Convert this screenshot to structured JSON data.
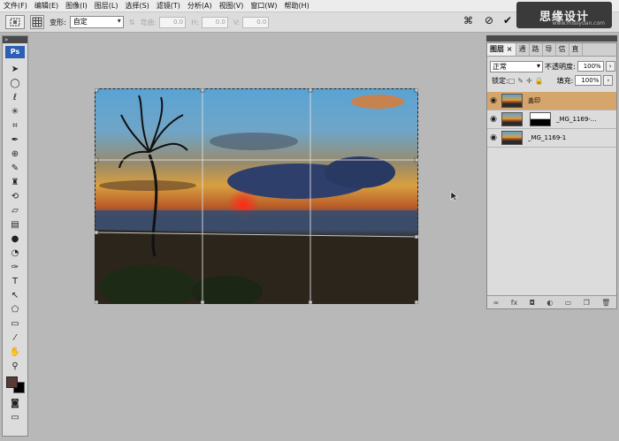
{
  "menubar": {
    "items": [
      "文件(F)",
      "编辑(E)",
      "图像(I)",
      "图层(L)",
      "选择(S)",
      "滤镜(T)",
      "分析(A)",
      "视图(V)",
      "窗口(W)",
      "帮助(H)"
    ]
  },
  "logo": {
    "main": "思缘设计",
    "sub": "www.missyuan.com"
  },
  "options_bar": {
    "transform_label": "变形:",
    "transform_value": "自定",
    "bend_label": "弯曲:",
    "bend_value": "0.0",
    "h_label": "H:",
    "h_value": "0.0",
    "v_label": "V:",
    "v_value": "0.0",
    "cancel_icon": "cancel-icon",
    "commit_icon": "checkmark-icon"
  },
  "toolbox": {
    "badge": "Ps",
    "tools": [
      "move-icon",
      "marquee-icon",
      "lasso-icon",
      "magic-wand-icon",
      "crop-icon",
      "eyedropper-icon",
      "healing-icon",
      "brush-icon",
      "stamp-icon",
      "history-brush-icon",
      "eraser-icon",
      "gradient-icon",
      "blur-icon",
      "dodge-icon",
      "pen-icon",
      "type-icon",
      "path-select-icon",
      "shape-icon",
      "notes-icon",
      "eyedropper2-icon",
      "hand-icon",
      "zoom-icon"
    ],
    "type_glyph": "T",
    "colors": {
      "foreground": "#5a3a35",
      "background": "#000000"
    }
  },
  "layers_panel": {
    "tabs": [
      "图层 ×",
      "通",
      "路",
      "导",
      "信",
      "直"
    ],
    "blend_mode": "正常",
    "opacity_label": "不透明度:",
    "opacity_value": "100%",
    "lock_label": "锁定:",
    "fill_label": "填充:",
    "fill_value": "100%",
    "layers": [
      {
        "name": "盖印",
        "selected": true,
        "has_mask": false
      },
      {
        "name": "_MG_1169-...",
        "selected": false,
        "has_mask": true
      },
      {
        "name": "_MG_1169-1",
        "selected": false,
        "has_mask": false
      }
    ]
  }
}
